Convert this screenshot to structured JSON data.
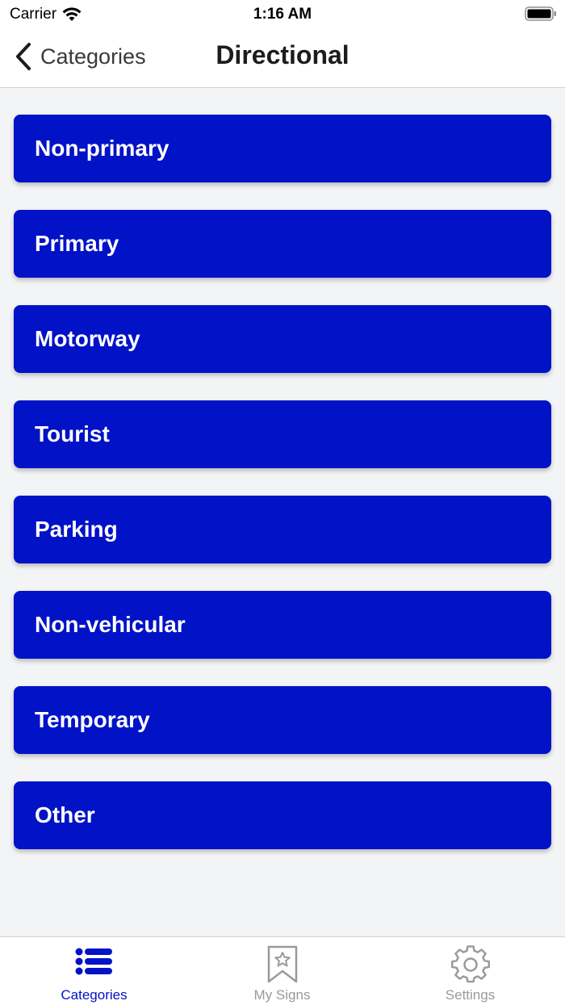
{
  "status_bar": {
    "carrier": "Carrier",
    "time": "1:16 AM"
  },
  "nav": {
    "back_label": "Categories",
    "title": "Directional"
  },
  "categories": [
    {
      "label": "Non-primary"
    },
    {
      "label": "Primary"
    },
    {
      "label": "Motorway"
    },
    {
      "label": "Tourist"
    },
    {
      "label": "Parking"
    },
    {
      "label": "Non-vehicular"
    },
    {
      "label": "Temporary"
    },
    {
      "label": "Other"
    }
  ],
  "tabs": [
    {
      "label": "Categories",
      "icon": "list-icon",
      "active": true
    },
    {
      "label": "My Signs",
      "icon": "bookmark-star-icon",
      "active": false
    },
    {
      "label": "Settings",
      "icon": "gear-icon",
      "active": false
    }
  ],
  "colors": {
    "accent": "#0212c7",
    "background": "#f3f4f6",
    "inactive_tab": "#9a9a9e"
  }
}
